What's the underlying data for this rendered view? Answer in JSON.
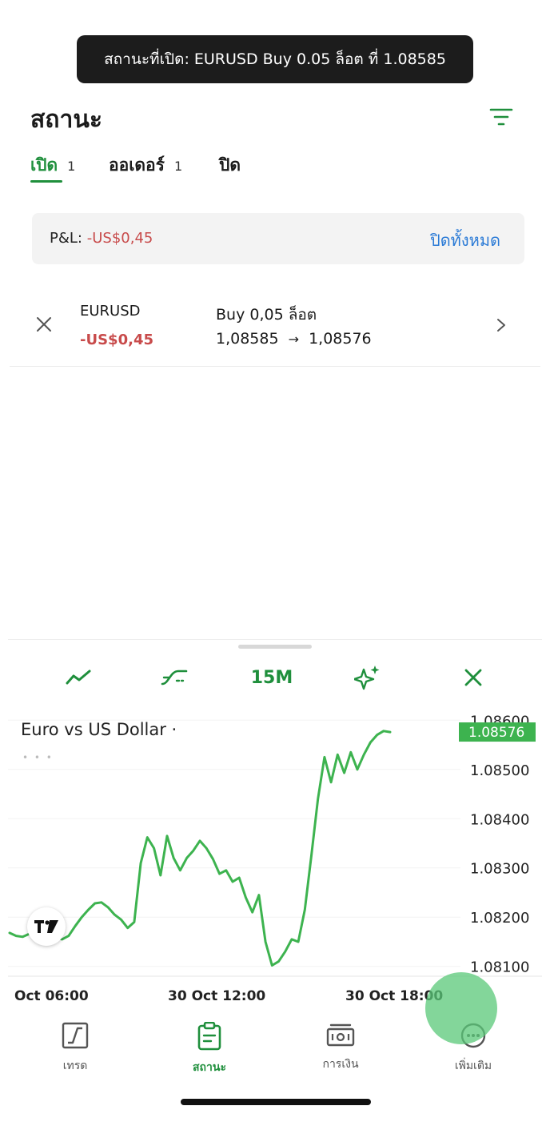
{
  "toast": {
    "text": "สถานะที่เปิด: EURUSD Buy 0.05 ล็อต ที่ 1.08585"
  },
  "header": {
    "title": "สถานะ",
    "filter_icon": "filter-icon"
  },
  "tabs": [
    {
      "label": "เปิด",
      "count": "1",
      "active": true
    },
    {
      "label": "ออเดอร์",
      "count": "1",
      "active": false
    },
    {
      "label": "ปิด",
      "count": "",
      "active": false
    }
  ],
  "pnl": {
    "label": "P&L:",
    "value": "-US$0,45",
    "close_all": "ปิดทั้งหมด"
  },
  "position": {
    "symbol": "EURUSD",
    "pnl": "-US$0,45",
    "side": "Buy 0,05 ล็อต",
    "open_price": "1,08585",
    "arrow": "→",
    "current_price": "1,08576"
  },
  "chart_toolbar": {
    "timeframe": "15M"
  },
  "chart": {
    "title": "Euro vs US Dollar ·",
    "dots": "• • •",
    "logo": "TV"
  },
  "chart_data": {
    "type": "line",
    "title": "Euro vs US Dollar ·",
    "color": "#3db34f",
    "x_tick_labels": [
      "Oct 06:00",
      "30 Oct 12:00",
      "30 Oct 18:00"
    ],
    "y_tick_labels": [
      "1.08600",
      "1.08500",
      "1.08400",
      "1.08300",
      "1.08200",
      "1.08100"
    ],
    "ylim": [
      1.0808,
      1.0862
    ],
    "last_price_label": "1.08576",
    "x": [
      0,
      1,
      2,
      3,
      4,
      5,
      6,
      7,
      8,
      9,
      10,
      11,
      12,
      13,
      14,
      15,
      16,
      17,
      18,
      19,
      20,
      21,
      22,
      23,
      24,
      25,
      26,
      27,
      28,
      29,
      30,
      31,
      32,
      33,
      34,
      35,
      36,
      37,
      38,
      39,
      40,
      41,
      42,
      43,
      44,
      45,
      46,
      47,
      48,
      49,
      50,
      51,
      52,
      53,
      54,
      55,
      56,
      57,
      58
    ],
    "values": [
      1.08168,
      1.08162,
      1.0816,
      1.08166,
      1.0817,
      1.08168,
      1.08163,
      1.08158,
      1.08155,
      1.08162,
      1.08182,
      1.082,
      1.08215,
      1.08228,
      1.0823,
      1.0822,
      1.08205,
      1.08195,
      1.08178,
      1.0819,
      1.0831,
      1.08362,
      1.0834,
      1.08285,
      1.08365,
      1.0832,
      1.08295,
      1.0832,
      1.08335,
      1.08355,
      1.0834,
      1.08318,
      1.08288,
      1.08295,
      1.08272,
      1.0828,
      1.0824,
      1.0821,
      1.08245,
      1.0815,
      1.08102,
      1.0811,
      1.0813,
      1.08155,
      1.0815,
      1.08215,
      1.08325,
      1.0844,
      1.08525,
      1.08474,
      1.0853,
      1.08493,
      1.08535,
      1.085,
      1.0853,
      1.08555,
      1.0857,
      1.08578,
      1.08576
    ]
  },
  "nav": [
    {
      "label": "เทรด",
      "icon": "trade-icon",
      "active": false
    },
    {
      "label": "สถานะ",
      "icon": "positions-icon",
      "active": true
    },
    {
      "label": "การเงิน",
      "icon": "finance-icon",
      "active": false
    },
    {
      "label": "เพิ่มเติม",
      "icon": "more-icon",
      "active": false
    }
  ],
  "colors": {
    "accent": "#1f8f3c",
    "negative": "#c84b4b",
    "link": "#2a7ad6",
    "chart_line": "#3db34f"
  }
}
